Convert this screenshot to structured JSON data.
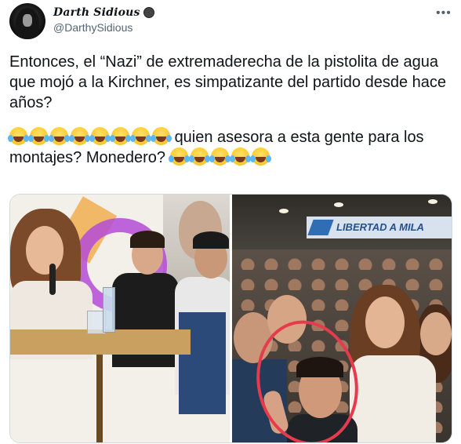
{
  "tweet": {
    "author": {
      "display_name": "Darth Sidious",
      "handle": "@DarthySidious"
    },
    "more_icon": "more-horizontal-icon",
    "text": {
      "paragraph1": "Entonces, el “Nazi” de extremaderecha de la pistolita de agua que mojó a la Kirchner, es simpatizante del partido desde hace años?",
      "paragraph2_part1": "quien asesora a esta gente para los montajes? Monedero?",
      "emoji_name": "face-with-tears-of-joy",
      "emoji_count_before": 8,
      "emoji_count_after": 5
    },
    "media": {
      "right_photo_banner": "LIBERTAD A MILA",
      "circle_color": "#e53b4d"
    }
  },
  "colors": {
    "text_primary": "#0f1419",
    "text_secondary": "#536471",
    "border": "#cfd9de"
  }
}
